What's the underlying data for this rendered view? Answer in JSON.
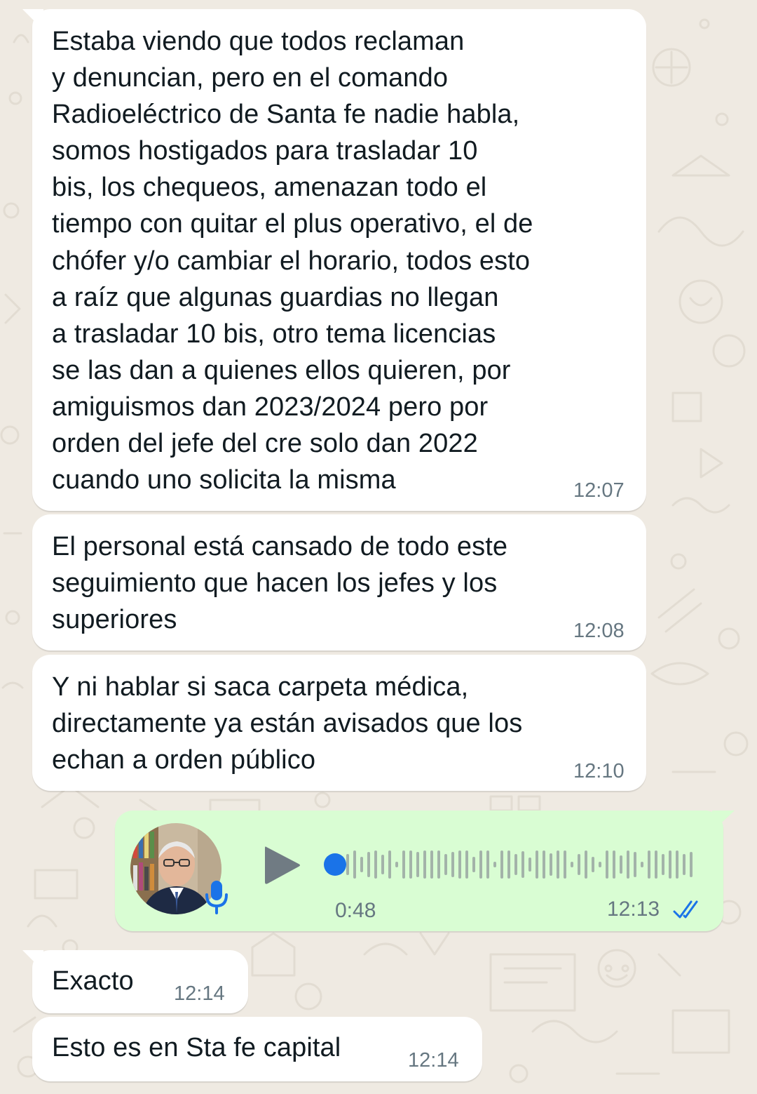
{
  "colors": {
    "wallpaper": "#efeae2",
    "incoming_bubble": "#ffffff",
    "outgoing_bubble": "#d9fdd3",
    "text": "#111b21",
    "meta_text": "#667781",
    "accent_blue": "#1a73e8",
    "waveform": "#a3b3a9"
  },
  "messages": [
    {
      "direction": "incoming",
      "text": "Estaba viendo que todos reclaman\ny denuncian, pero en el comando\nRadioeléctrico de Santa fe nadie habla,\nsomos hostigados para trasladar 10\nbis, los chequeos, amenazan todo el\ntiempo con quitar el plus operativo, el de\nchófer y/o cambiar el horario, todos esto\na raíz que algunas guardias no llegan\na trasladar 10 bis, otro tema licencias\nse las dan a quienes ellos quieren, por\namiguismos dan 2023/2024 pero por\norden del jefe del cre solo dan 2022\ncuando uno solicita la misma",
      "time": "12:07"
    },
    {
      "direction": "incoming",
      "text": "El personal está cansado de todo este\nseguimiento que hacen los jefes y los\nsuperiores",
      "time": "12:08"
    },
    {
      "direction": "incoming",
      "text": "Y ni hablar si saca carpeta médica,\ndirectamente ya están avisados que los\nechan a orden público",
      "time": "12:10"
    }
  ],
  "voice_message": {
    "direction": "outgoing",
    "avatar_icon": "person-avatar",
    "mic_icon": "microphone-icon",
    "play_icon": "play-icon",
    "duration": "0:48",
    "time": "12:13",
    "status_icon": "double-check-read-icon",
    "progress": 0
  },
  "later_messages": [
    {
      "direction": "incoming",
      "text": "Exacto",
      "time": "12:14"
    },
    {
      "direction": "incoming",
      "text": "Esto es en Sta fe capital",
      "time": "12:14"
    }
  ]
}
